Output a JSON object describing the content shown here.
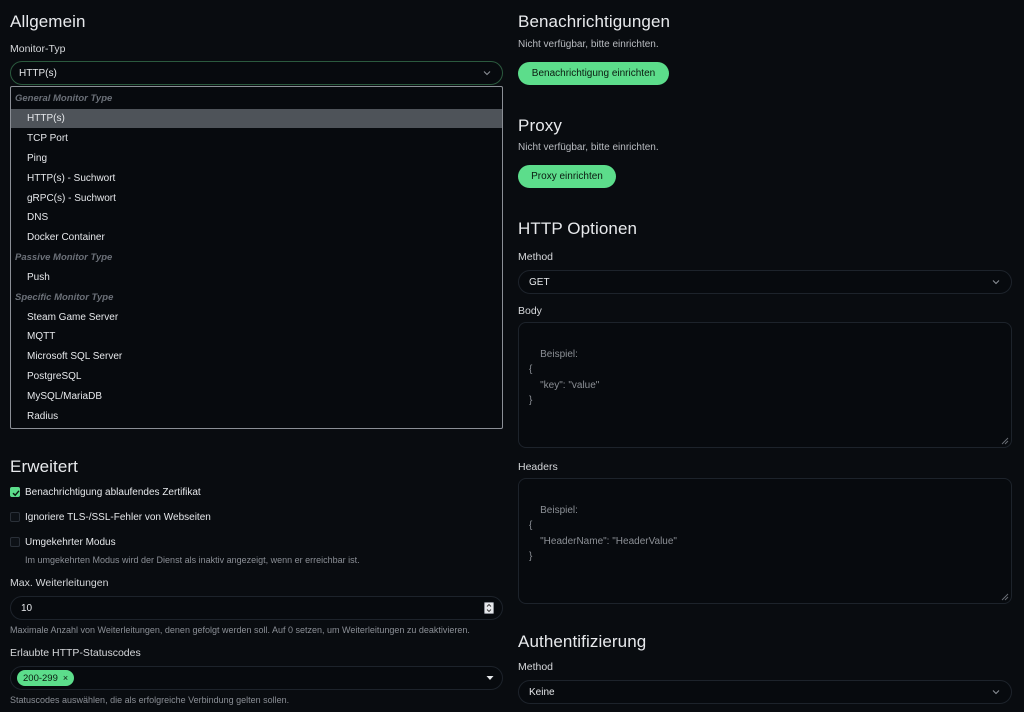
{
  "allgemein": {
    "heading": "Allgemein",
    "monitor_type_label": "Monitor-Typ",
    "monitor_type_value": "HTTP(s)",
    "dropdown": {
      "groups": [
        {
          "label": "General Monitor Type",
          "items": [
            "HTTP(s)",
            "TCP Port",
            "Ping",
            "HTTP(s) - Suchwort",
            "gRPC(s) - Suchwort",
            "DNS",
            "Docker Container"
          ]
        },
        {
          "label": "Passive Monitor Type",
          "items": [
            "Push"
          ]
        },
        {
          "label": "Specific Monitor Type",
          "items": [
            "Steam Game Server",
            "MQTT",
            "Microsoft SQL Server",
            "PostgreSQL",
            "MySQL/MariaDB",
            "Radius"
          ]
        }
      ],
      "selected": "HTTP(s)"
    }
  },
  "erweitert": {
    "heading": "Erweitert",
    "cert_expiry": {
      "label": "Benachrichtigung ablaufendes Zertifikat",
      "checked": true
    },
    "ignore_tls": {
      "label": "Ignoriere TLS-/SSL-Fehler von Webseiten",
      "checked": false
    },
    "upside_down": {
      "label": "Umgekehrter Modus",
      "checked": false,
      "hint": "Im umgekehrten Modus wird der Dienst als inaktiv angezeigt, wenn er erreichbar ist."
    },
    "max_redirects": {
      "label": "Max. Weiterleitungen",
      "value": "10",
      "hint": "Maximale Anzahl von Weiterleitungen, denen gefolgt werden soll. Auf 0 setzen, um Weiterleitungen zu deaktivieren."
    },
    "status_codes": {
      "label": "Erlaubte HTTP-Statuscodes",
      "tag": "200-299",
      "tag_remove": "×",
      "hint": "Statuscodes auswählen, die als erfolgreiche Verbindung gelten sollen."
    }
  },
  "notifications": {
    "heading": "Benachrichtigungen",
    "unavailable": "Nicht verfügbar, bitte einrichten.",
    "button": "Benachrichtigung einrichten"
  },
  "proxy": {
    "heading": "Proxy",
    "unavailable": "Nicht verfügbar, bitte einrichten.",
    "button": "Proxy einrichten"
  },
  "http_options": {
    "heading": "HTTP Optionen",
    "method_label": "Method",
    "method_value": "GET",
    "body_label": "Body",
    "body_placeholder": "Beispiel:\n{\n    \"key\": \"value\"\n}",
    "headers_label": "Headers",
    "headers_placeholder": "Beispiel:\n{\n    \"HeaderName\": \"HeaderValue\"\n}"
  },
  "auth": {
    "heading": "Authentifizierung",
    "method_label": "Method",
    "method_value": "Keine"
  },
  "colors": {
    "accent": "#5cdd8b",
    "background": "#090c10",
    "selected_row": "#4e5359"
  },
  "icons": {
    "select_arrow": "chevron-down-icon",
    "checkbox_check": "check-icon",
    "number_spin": "spinner-icon",
    "multiselect_caret": "caret-down-icon"
  }
}
